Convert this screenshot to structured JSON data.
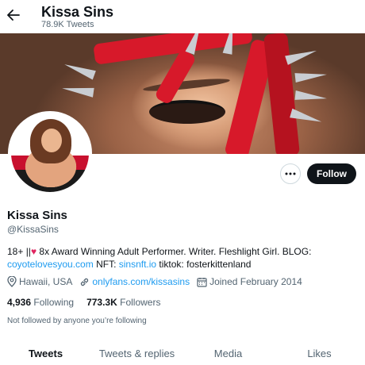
{
  "header": {
    "name": "Kissa Sins",
    "tweet_count": "78.9K Tweets"
  },
  "profile": {
    "display_name": "Kissa Sins",
    "handle": "@KissaSins",
    "follow_label": "Follow",
    "bio_prefix": "18+ ||",
    "bio_text": " 8x Award Winning Adult Performer. Writer. Fleshlight Girl. BLOG: ",
    "bio_link1": "coyotelovesyou.com",
    "bio_nft": " NFT: ",
    "bio_link2": "sinsnft.io",
    "bio_suffix": " tiktok: fosterkittenland",
    "location": "Hawaii, USA",
    "website": "onlyfans.com/kissasins",
    "joined": "Joined February 2014",
    "following_count": "4,936",
    "following_label": "Following",
    "followers_count": "773.3K",
    "followers_label": "Followers",
    "not_followed_text": "Not followed by anyone you’re following"
  },
  "tabs": [
    {
      "label": "Tweets"
    },
    {
      "label": "Tweets & replies"
    },
    {
      "label": "Media"
    },
    {
      "label": "Likes"
    }
  ],
  "colors": {
    "accent": "#1d9bf0",
    "text": "#0f1419",
    "secondary": "#536471",
    "heart": "#e0245e"
  },
  "icons": {
    "back": "arrow-left-icon",
    "more": "more-dots-icon",
    "location": "location-pin-icon",
    "link": "link-icon",
    "calendar": "calendar-icon"
  }
}
